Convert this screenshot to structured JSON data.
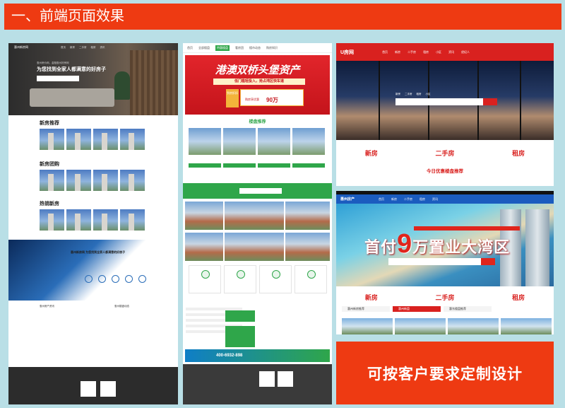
{
  "title": "一、前端页面效果",
  "cta": "可按客户要求定制设计",
  "panel1": {
    "logo": "惠州新房网",
    "nav": [
      "首页",
      "新房",
      "二手房",
      "租房",
      "资讯"
    ],
    "hero_sub": "惠州房价网，金融惠州好房网",
    "hero_slogan": "为您找到全家人都满意的好房子",
    "sections": [
      "新房推荐",
      "新房团购",
      "热销新房"
    ],
    "blue_title": "惠州新房网 为您找到全家人都满意的好房子",
    "news_left": "惠州房产资讯",
    "news_right": "惠州楼盘动态"
  },
  "panel2": {
    "nav": [
      "首页",
      "全部楼盘",
      "特惠楼盘",
      "看房团",
      "楼市动态",
      "购房知识"
    ],
    "nav_active": "特惠楼盘",
    "banner_title": "港澳双桥头堡资产",
    "banner_sub": "低门槛轻投入，抢占湾区快车道",
    "tag": "到房折扣",
    "ticket_big": "90万",
    "ticket_note": "购房享优惠",
    "section": "楼盘推荐",
    "phone": "400-6932-898"
  },
  "panel3": {
    "logo": "U房网",
    "nav": [
      "首页",
      "新房",
      "二手房",
      "租房",
      "小区",
      "资讯",
      "经纪人"
    ],
    "search_tabs": [
      "新房",
      "二手房",
      "租房",
      "小区"
    ],
    "categories": [
      "新房",
      "二手房",
      "租房"
    ],
    "today": "今日优惠楼盘推荐"
  },
  "panel4": {
    "logo": "惠州房产",
    "nav": [
      "首页",
      "新房",
      "二手房",
      "租房",
      "资讯"
    ],
    "slogan_pre": "首付",
    "slogan_num": "9",
    "slogan_post": "万置业大湾区",
    "categories": [
      "新房",
      "二手房",
      "租房"
    ],
    "subtabs": [
      "惠州新房推荐",
      "惠州新盘",
      "惠东楼盘推荐"
    ]
  }
}
